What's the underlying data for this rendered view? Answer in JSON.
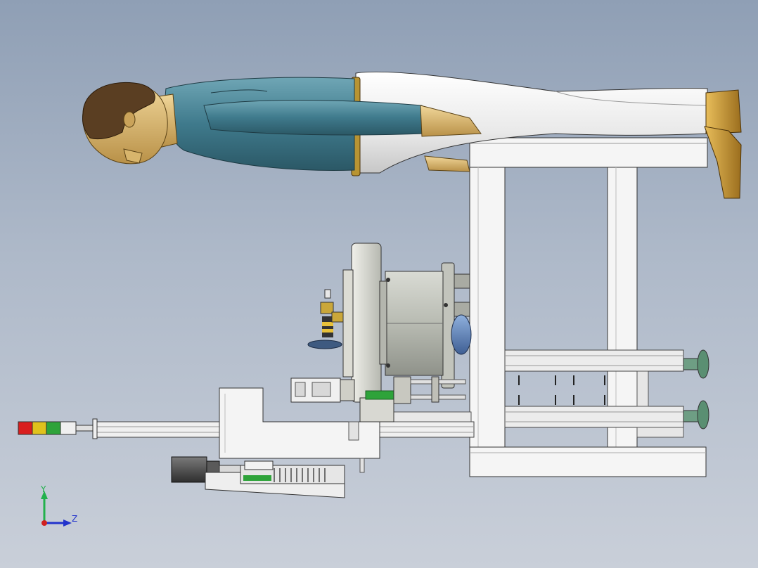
{
  "viewport": {
    "background_top": "#8f9fb5",
    "background_bottom": "#c9cfd9"
  },
  "triad": {
    "y_label": "Y",
    "z_label": "Z",
    "y_color": "#22b14c",
    "z_color": "#2233cc",
    "origin_color": "#d02020"
  },
  "model": {
    "figure": {
      "hair_color": "#5a3e22",
      "skin_color": "#d9b46a",
      "jacket_color": "#3f7a8c",
      "pants_color": "#f2f2f2",
      "shoe_color": "#c8962e",
      "belt_color": "#9a7a2a"
    },
    "frame_color": "#f4f4f4",
    "housing_color": "#c4c7bf",
    "hub_color": "#5d7fb2",
    "rail_color": "#e8e8e8",
    "stack_light": [
      "#d91e1e",
      "#e0c21c",
      "#2ea33a",
      "#f0f0f0"
    ]
  }
}
